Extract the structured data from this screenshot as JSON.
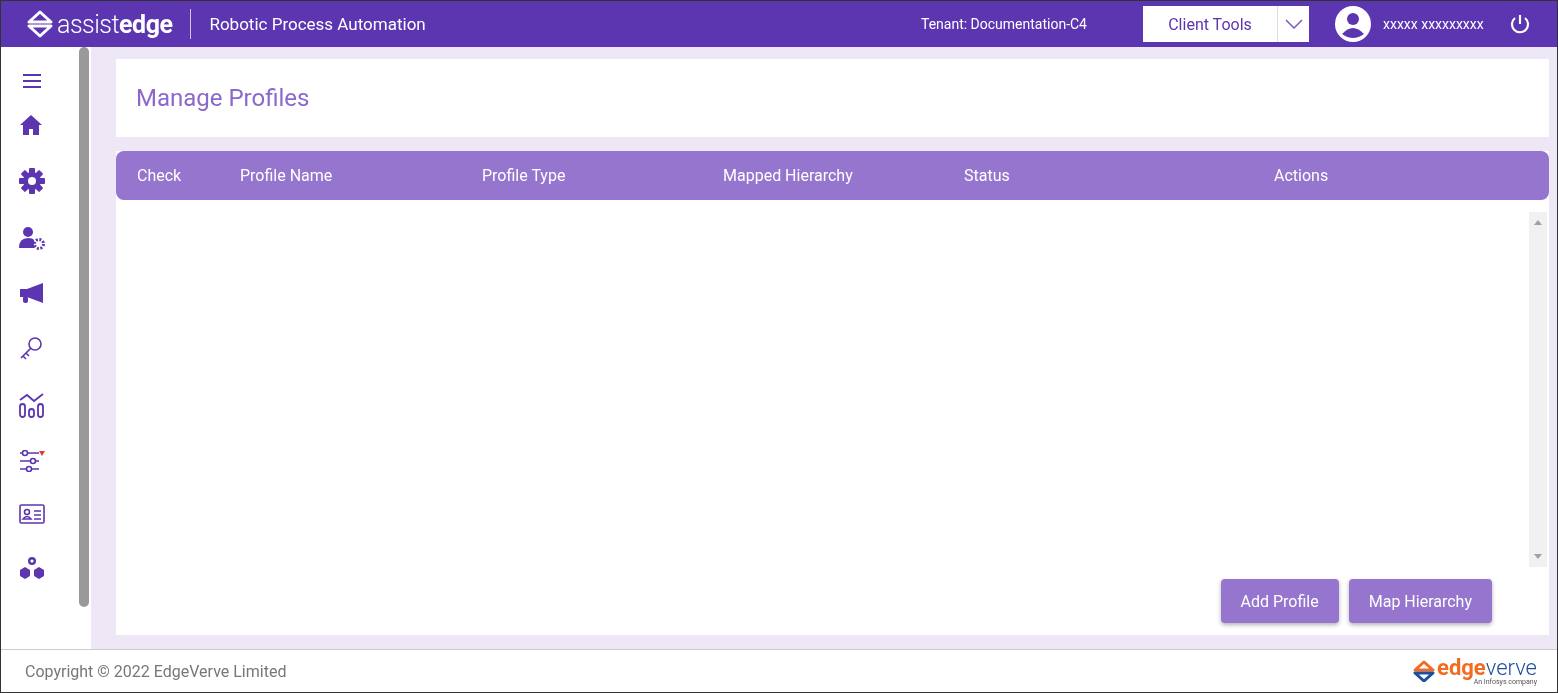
{
  "header": {
    "logo": {
      "light": "assist",
      "bold": "edge"
    },
    "app_title": "Robotic Process Automation",
    "tenant": "Tenant: Documentation-C4",
    "client_tools": "Client Tools",
    "user_name": "xxxxx xxxxxxxxx"
  },
  "sidebar": {
    "items": [
      {
        "kind": "home"
      },
      {
        "kind": "gear"
      },
      {
        "kind": "user-gear"
      },
      {
        "kind": "megaphone"
      },
      {
        "kind": "key"
      },
      {
        "kind": "chart"
      },
      {
        "kind": "sliders"
      },
      {
        "kind": "id-card"
      },
      {
        "kind": "cubes"
      }
    ]
  },
  "page": {
    "title": "Manage Profiles"
  },
  "table": {
    "columns": [
      "Check",
      "Profile Name",
      "Profile Type",
      "Mapped Hierarchy",
      "Status",
      "Actions"
    ]
  },
  "buttons": [
    "Add Profile",
    "Map Hierarchy"
  ],
  "footer": {
    "copyright": "Copyright © 2022 EdgeVerve Limited",
    "brand": {
      "bold": "edge",
      "light": "verve",
      "tagline": "An Infosys company"
    }
  }
}
